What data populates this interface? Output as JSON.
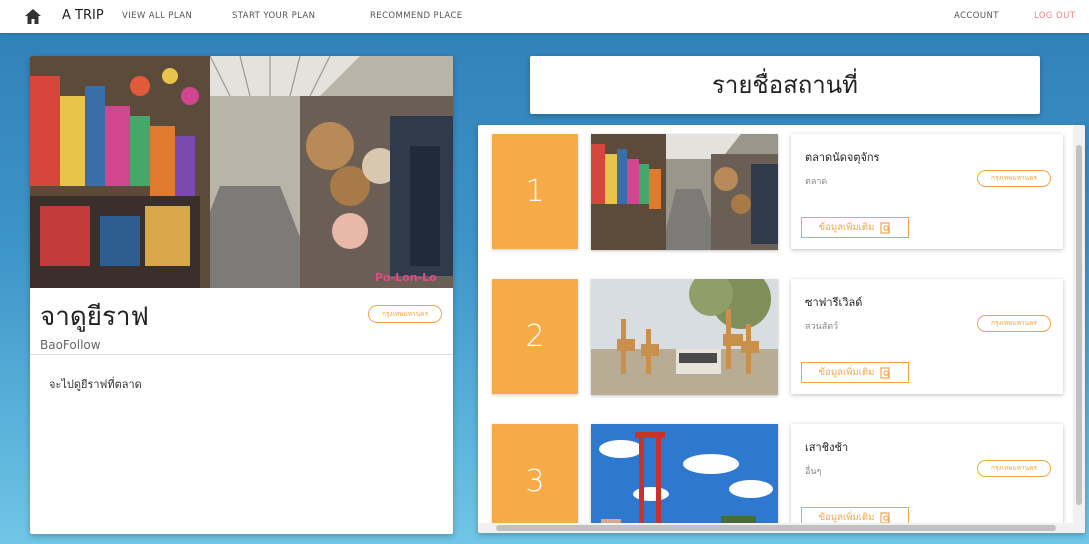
{
  "nav": {
    "brand": "A TRIP",
    "view_all": "VIEW ALL PLAN",
    "start_plan": "START YOUR PLAN",
    "recommend": "RECOMMEND PLACE",
    "account": "ACCOUNT",
    "logout": "LOG OUT"
  },
  "detail": {
    "title": "จาดูยีราฟ",
    "user": "BaoFollow",
    "province": "กรุงเทพมหานคร",
    "description": "จะไปดูยีราฟที่ตลาด",
    "photo_watermark": "Po-Lon-Lo"
  },
  "list": {
    "heading": "รายชื่อสถานที่",
    "more_label": "ข้อมูลเพิ่มเติม",
    "items": [
      {
        "number": "1",
        "name": "ตลาดนัดจตุจักร",
        "category": "ตลาด",
        "province": "กรุงเทพมหานคร"
      },
      {
        "number": "2",
        "name": "ซาฟารีเวิลด์",
        "category": "สวนสัตว์",
        "province": "กรุงเทพมหานคร"
      },
      {
        "number": "3",
        "name": "เสาชิงช้า",
        "category": "อื่นๆ",
        "province": "กรุงเทพมหานคร"
      }
    ]
  },
  "colors": {
    "accent": "#f7ab48",
    "logout": "#f08080",
    "background_top": "#2f7fb6",
    "background_bottom": "#6fc6e6"
  }
}
